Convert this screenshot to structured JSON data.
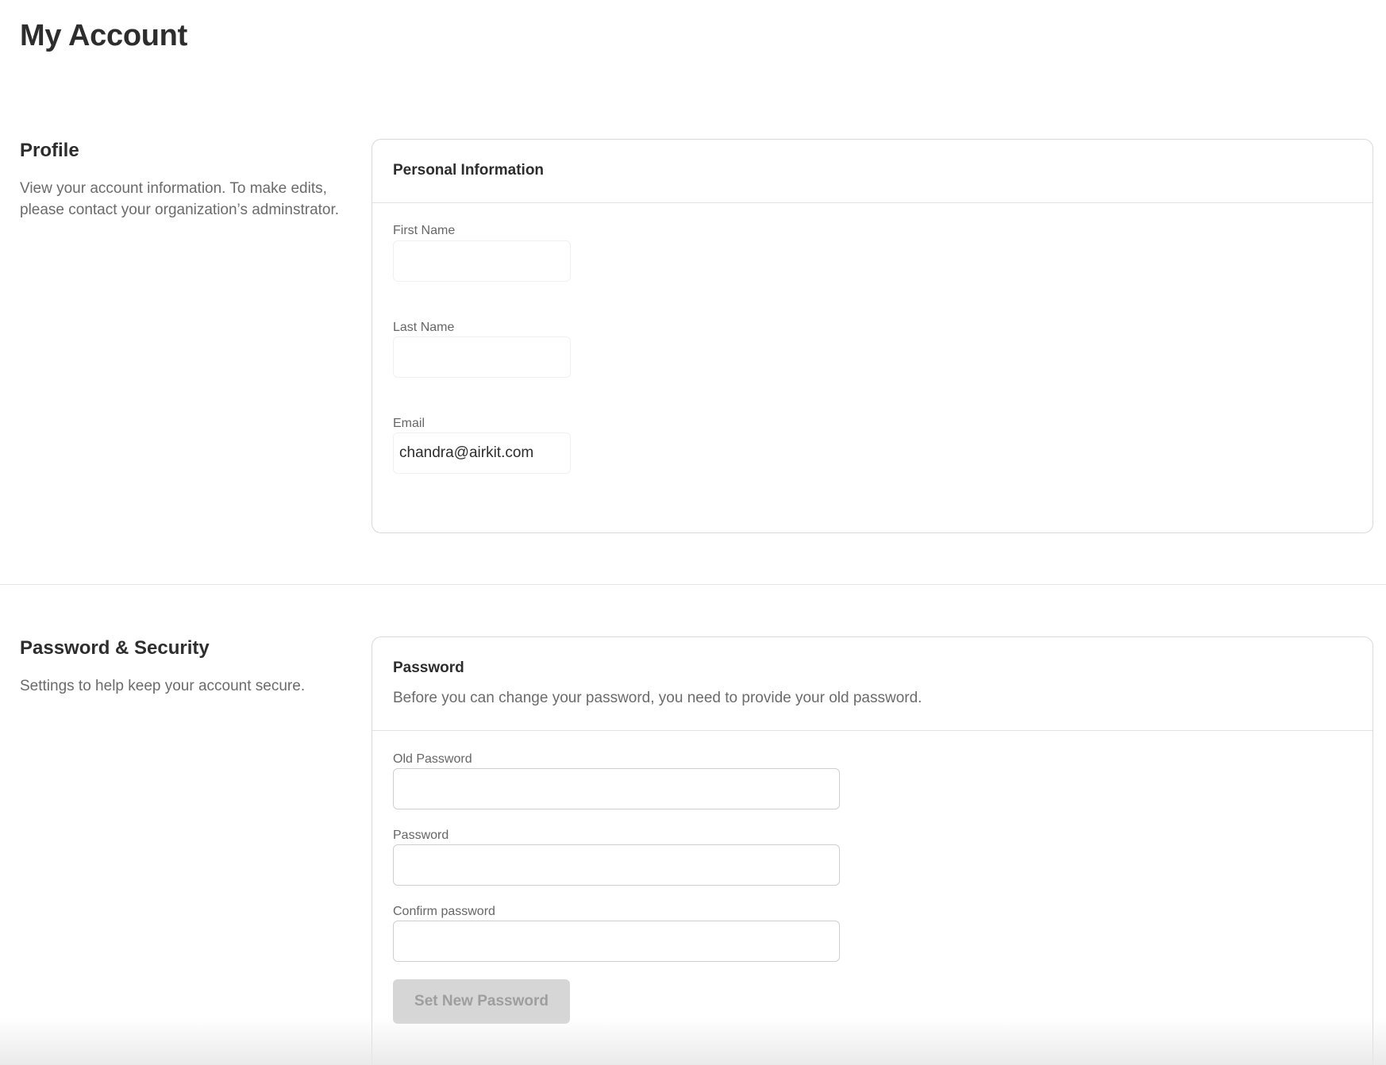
{
  "page": {
    "title": "My Account"
  },
  "profile_section": {
    "heading": "Profile",
    "description": "View your account information. To make edits, please contact your organization’s adminstrator.",
    "card": {
      "title": "Personal Information",
      "fields": {
        "first_name": {
          "label": "First Name",
          "value": ""
        },
        "last_name": {
          "label": "Last Name",
          "value": ""
        },
        "email": {
          "label": "Email",
          "value": "chandra@airkit.com"
        }
      }
    }
  },
  "security_section": {
    "heading": "Password & Security",
    "description": "Settings to help keep your account secure.",
    "card": {
      "title": "Password",
      "subtitle": "Before you can change your password, you need to provide your old password.",
      "fields": {
        "old_password": {
          "label": "Old Password",
          "value": ""
        },
        "password": {
          "label": "Password",
          "value": ""
        },
        "confirm_password": {
          "label": "Confirm password",
          "value": ""
        }
      },
      "submit_label": "Set New Password",
      "submit_disabled": true
    }
  }
}
